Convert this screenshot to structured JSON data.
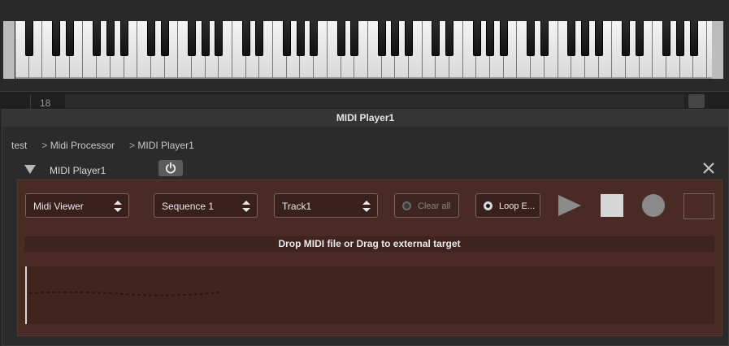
{
  "track": {
    "number": "18"
  },
  "panel": {
    "title": "MIDI Player1"
  },
  "breadcrumb": [
    "test",
    "Midi Processor",
    "MIDI Player1"
  ],
  "processor": {
    "name": "MIDI Player1"
  },
  "controls": {
    "viewer_select": "Midi Viewer",
    "sequence_select": "Sequence 1",
    "track_select": "Track1",
    "clear_all": "Clear all",
    "loop": "Loop E..."
  },
  "drop_text": "Drop MIDI file or Drag to external target",
  "colors": {
    "content_bg": "#4a2a25",
    "panel_bg": "#2b2b2b",
    "accent_stop": "#d6d6d6"
  },
  "icons": {
    "power": "power-icon",
    "close": "close-icon",
    "collapse": "triangle-down-icon",
    "play": "play-icon",
    "stop": "stop-icon",
    "record": "record-icon"
  }
}
